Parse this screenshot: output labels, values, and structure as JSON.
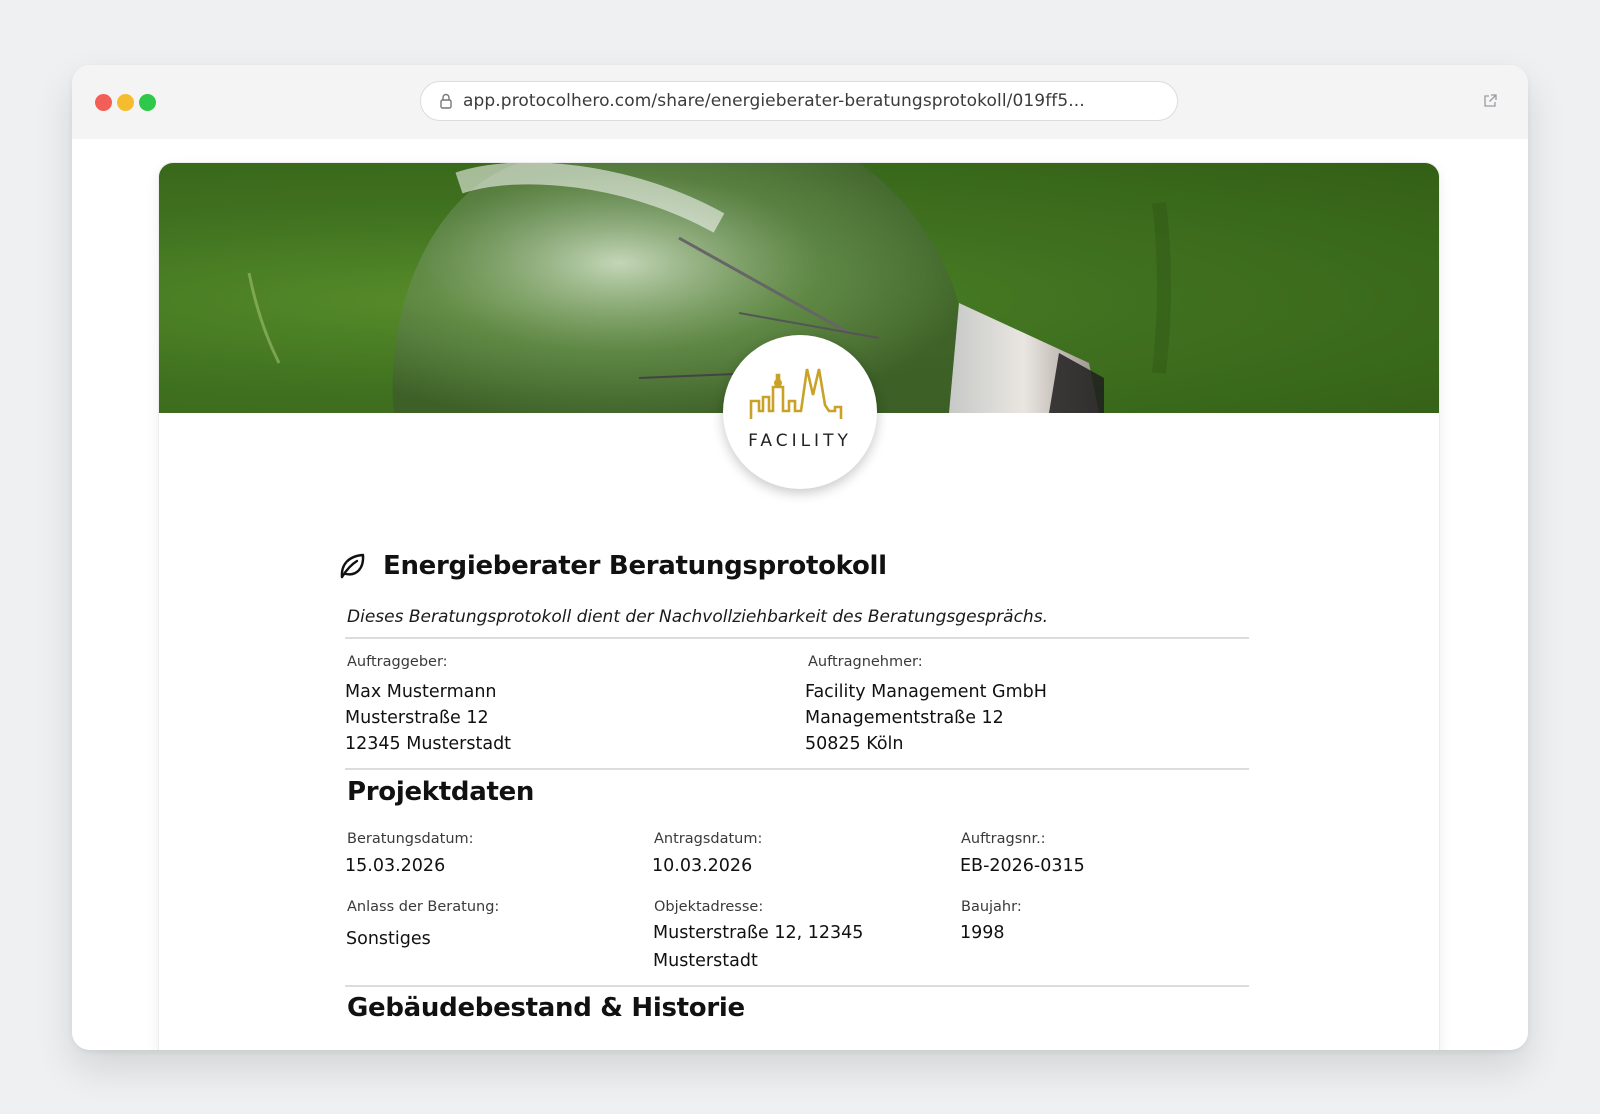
{
  "browser": {
    "url": "app.protocolhero.com/share/energieberater-beratungsprotokoll/019ff5..."
  },
  "logo": {
    "text": "FACILITY",
    "accent": "#c9a227"
  },
  "document": {
    "title": "Energieberater Beratungsprotokoll",
    "subtitle": "Dieses Beratungsprotokoll dient der Nachvollziehbarkeit des Beratungsgesprächs.",
    "client": {
      "label": "Auftraggeber:",
      "line1": "Max Mustermann",
      "line2": "Musterstraße 12",
      "line3": "12345 Musterstadt"
    },
    "contractor": {
      "label": "Auftragnehmer:",
      "line1": "Facility Management GmbH",
      "line2": "Managementstraße 12",
      "line3": "50825 Köln"
    },
    "project": {
      "heading": "Projektdaten",
      "consultation_date": {
        "label": "Beratungsdatum:",
        "value": "15.03.2026"
      },
      "application_date": {
        "label": "Antragsdatum:",
        "value": "10.03.2026"
      },
      "order_no": {
        "label": "Auftragsnr.:",
        "value": "EB-2026-0315"
      },
      "occasion": {
        "label": "Anlass der Beratung:",
        "value": "Sonstiges"
      },
      "address": {
        "label": "Objektadresse:",
        "line1": "Musterstraße 12, 12345",
        "line2": "Musterstadt"
      },
      "year_built": {
        "label": "Baujahr:",
        "value": "1998"
      }
    },
    "building_heading": "Gebäudebestand & Historie"
  }
}
